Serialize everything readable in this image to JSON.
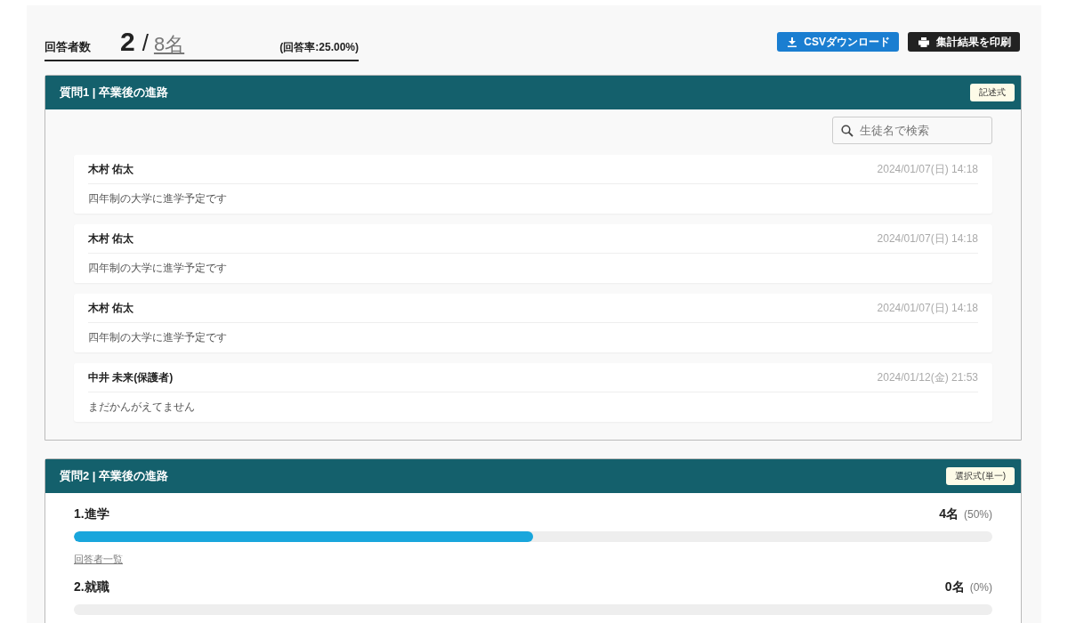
{
  "summary": {
    "label": "回答者数",
    "answered": "2",
    "separator": "/",
    "total": "8名",
    "rate": "(回答率:25.00%)"
  },
  "buttons": [
    {
      "kind": "download",
      "label": "CSVダウンロード"
    },
    {
      "kind": "print",
      "label": "集計結果を印刷"
    }
  ],
  "questions": [
    {
      "kind": "text",
      "title": "質問1 | 卒業後の進路",
      "badge": "記述式",
      "search": {
        "placeholder": "生徒名で検索"
      },
      "answers": [
        {
          "name": "木村 佑太",
          "date": "2024/01/07(日) 14:18",
          "text": "四年制の大学に進学予定です"
        },
        {
          "name": "木村 佑太",
          "date": "2024/01/07(日) 14:18",
          "text": "四年制の大学に進学予定です"
        },
        {
          "name": "木村 佑太",
          "date": "2024/01/07(日) 14:18",
          "text": "四年制の大学に進学予定です"
        },
        {
          "name": "中井 未来(保護者)",
          "date": "2024/01/12(金) 21:53",
          "text": "まだかんがえてません"
        }
      ]
    },
    {
      "kind": "choice",
      "title": "質問2 | 卒業後の進路",
      "badge": "選択式(単一)",
      "options": [
        {
          "label": "1.進学",
          "count": "4名",
          "percent": "(50%)",
          "level": 0.5,
          "link": "回答者一覧"
        },
        {
          "label": "2.就職",
          "count": "0名",
          "percent": "(0%)"
        }
      ]
    }
  ]
}
